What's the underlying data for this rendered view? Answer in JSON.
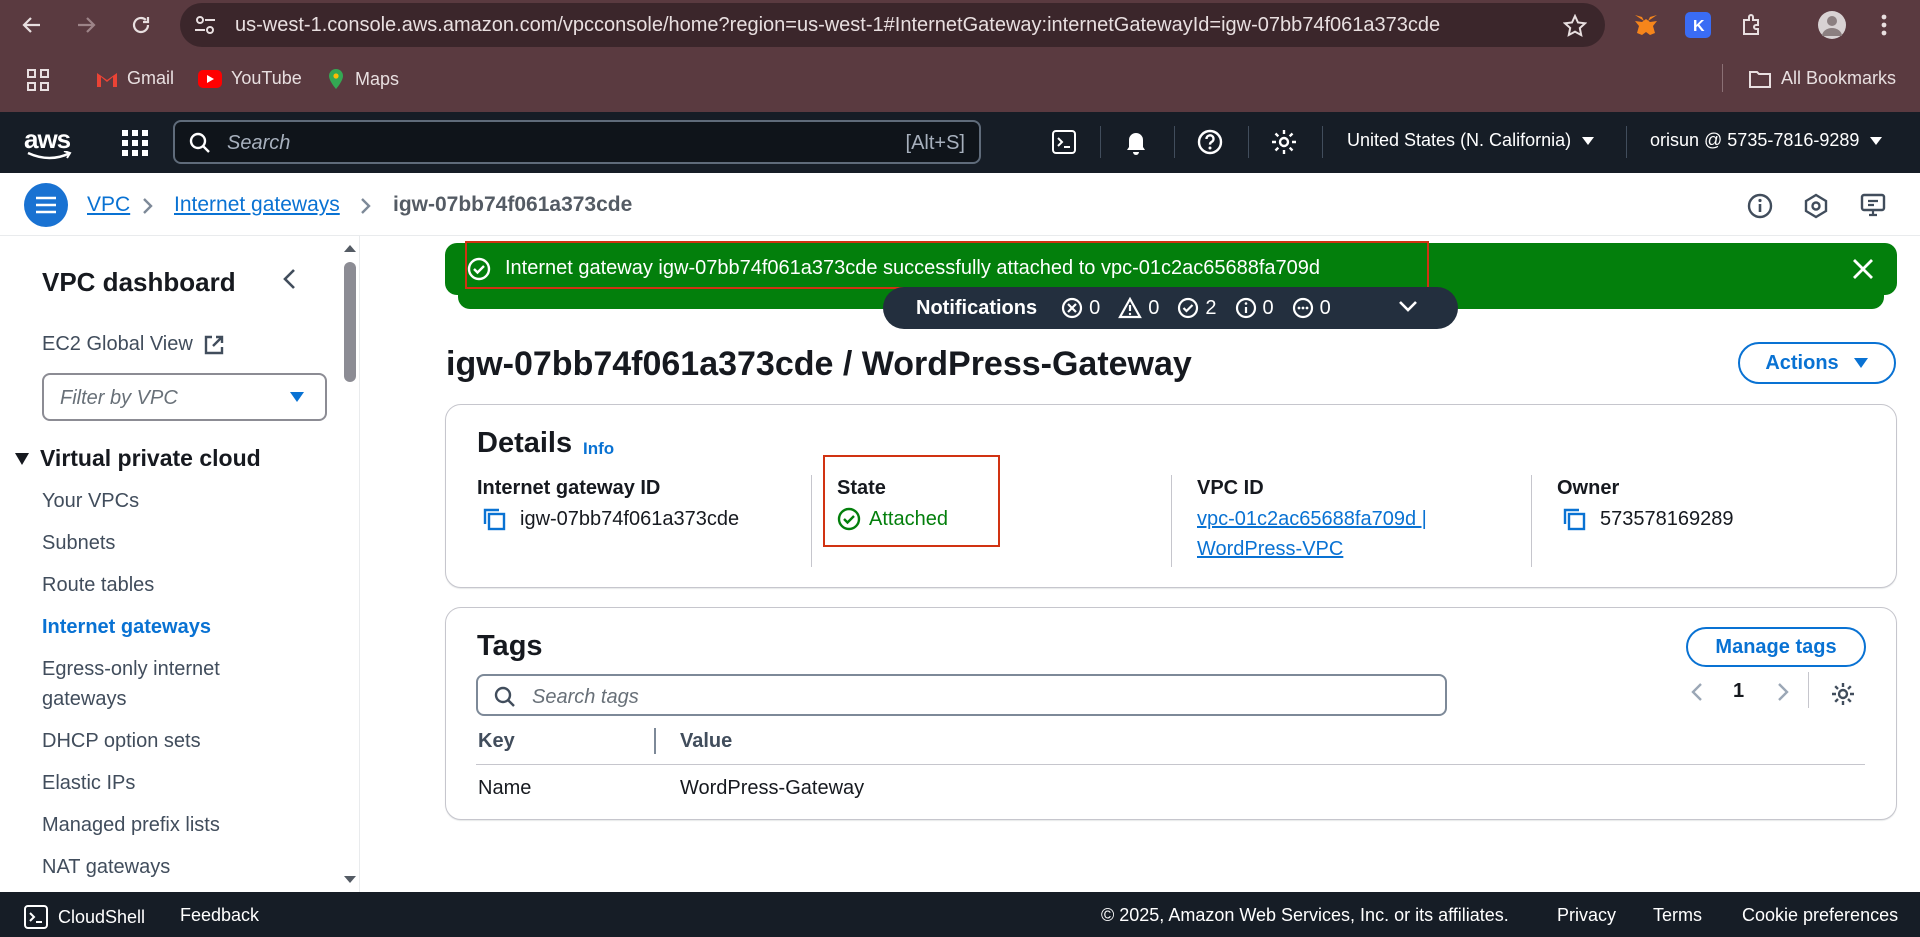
{
  "browser": {
    "url": "us-west-1.console.aws.amazon.com/vpcconsole/home?region=us-west-1#InternetGateway:internetGatewayId=igw-07bb74f061a373cde",
    "bookmarks": [
      "Gmail",
      "YouTube",
      "Maps"
    ],
    "all_bookmarks": "All Bookmarks"
  },
  "aws_header": {
    "logo": "aws",
    "search_placeholder": "Search",
    "search_shortcut": "[Alt+S]",
    "region": "United States (N. California)",
    "account": "orisun @ 5735-7816-9289"
  },
  "breadcrumb": {
    "items": [
      "VPC",
      "Internet gateways",
      "igw-07bb74f061a373cde"
    ]
  },
  "sidebar": {
    "title": "VPC dashboard",
    "global_view": "EC2 Global View",
    "filter_placeholder": "Filter by VPC",
    "section": "Virtual private cloud",
    "items": [
      "Your VPCs",
      "Subnets",
      "Route tables",
      "Internet gateways",
      "Egress-only internet gateways",
      "DHCP option sets",
      "Elastic IPs",
      "Managed prefix lists",
      "NAT gateways"
    ],
    "active_item": "Internet gateways"
  },
  "flash": {
    "message": "Internet gateway igw-07bb74f061a373cde successfully attached to vpc-01c2ac65688fa709d"
  },
  "notifications": {
    "label": "Notifications",
    "counts": {
      "error": "0",
      "warning": "0",
      "success": "2",
      "info": "0",
      "in_progress": "0"
    }
  },
  "page": {
    "title": "igw-07bb74f061a373cde / WordPress-Gateway",
    "actions_label": "Actions"
  },
  "details": {
    "title": "Details",
    "info": "Info",
    "igw_label": "Internet gateway ID",
    "igw_value": "igw-07bb74f061a373cde",
    "state_label": "State",
    "state_value": "Attached",
    "vpc_label": "VPC ID",
    "vpc_value_line1": "vpc-01c2ac65688fa709d |",
    "vpc_value_line2": "WordPress-VPC",
    "owner_label": "Owner",
    "owner_value": "573578169289"
  },
  "tags": {
    "title": "Tags",
    "manage_label": "Manage tags",
    "search_placeholder": "Search tags",
    "page": "1",
    "columns": [
      "Key",
      "Value"
    ],
    "rows": [
      {
        "key": "Name",
        "value": "WordPress-Gateway"
      }
    ]
  },
  "footer": {
    "cloudshell": "CloudShell",
    "feedback": "Feedback",
    "copyright": "© 2025, Amazon Web Services, Inc. or its affiliates.",
    "privacy": "Privacy",
    "terms": "Terms",
    "cookies": "Cookie preferences"
  },
  "colors": {
    "success_green": "#037f0c",
    "link_blue": "#0972d3",
    "header_dark": "#161d26",
    "browser_chrome": "#5a3a40"
  }
}
